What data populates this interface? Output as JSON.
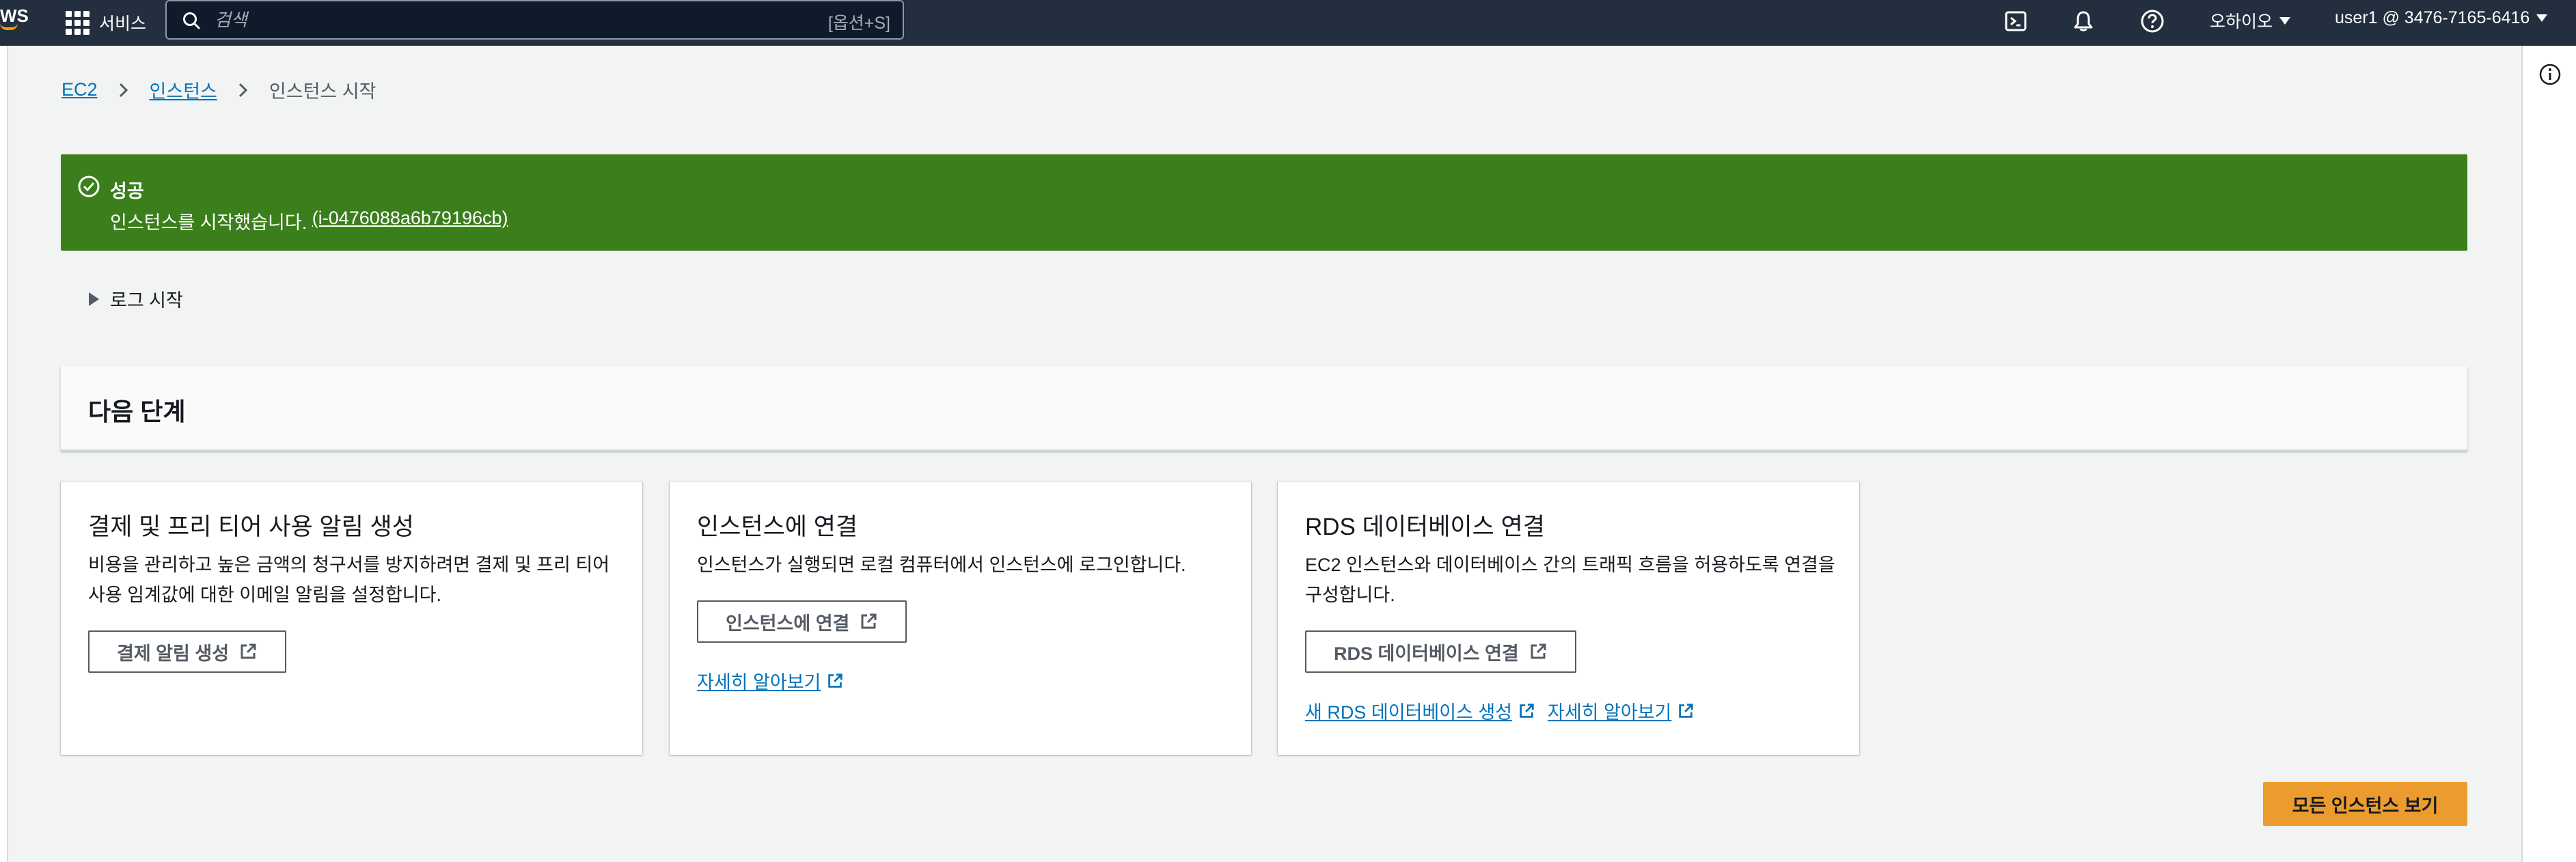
{
  "topnav": {
    "logo_text": "WS",
    "services_label": "서비스",
    "search": {
      "placeholder": "검색",
      "shortcut": "[옵션+S]"
    },
    "region_label": "오하이오",
    "account_label": "user1 @ 3476-7165-6416",
    "icons": [
      "cloudshell-icon",
      "bell-icon",
      "help-icon"
    ]
  },
  "breadcrumb": {
    "items": [
      {
        "label": "EC2"
      },
      {
        "label": "인스턴스"
      }
    ],
    "current": "인스턴스 시작"
  },
  "flash": {
    "title": "성공",
    "message": "인스턴스를 시작했습니다.",
    "instance_link": "(i-0476088a6b79196cb)",
    "color": "#3b7f1c"
  },
  "log_toggle": "로그 시작",
  "next_steps": {
    "title": "다음 단계",
    "cards": [
      {
        "title": "결제 및 프리 티어 사용 알림 생성",
        "desc_line1": "비용을 관리하고 높은 금액의 청구서를 방지하려면 결제 및 프리 티어",
        "desc_line2": "사용 임계값에 대한 이메일 알림을 설정합니다.",
        "button": "결제 알림 생성"
      },
      {
        "title": "인스턴스에 연결",
        "desc_line1": "인스턴스가 실행되면 로컬 컴퓨터에서 인스턴스에 로그인합니다.",
        "button": "인스턴스에 연결",
        "link": "자세히 알아보기"
      },
      {
        "title": "RDS 데이터베이스 연결",
        "desc_line1": "EC2 인스턴스와 데이터베이스 간의 트래픽 흐름을 허용하도록 연결을",
        "desc_line2": "구성합니다.",
        "button": "RDS 데이터베이스 연결",
        "link1": "새 RDS 데이터베이스 생성",
        "link2": "자세히 알아보기"
      }
    ]
  },
  "primary_button": "모든 인스턴스 보기",
  "colors": {
    "nav_bg": "#232f3e",
    "link": "#0073bb",
    "primary": "#ec9c2e",
    "success": "#3b7f1c"
  }
}
